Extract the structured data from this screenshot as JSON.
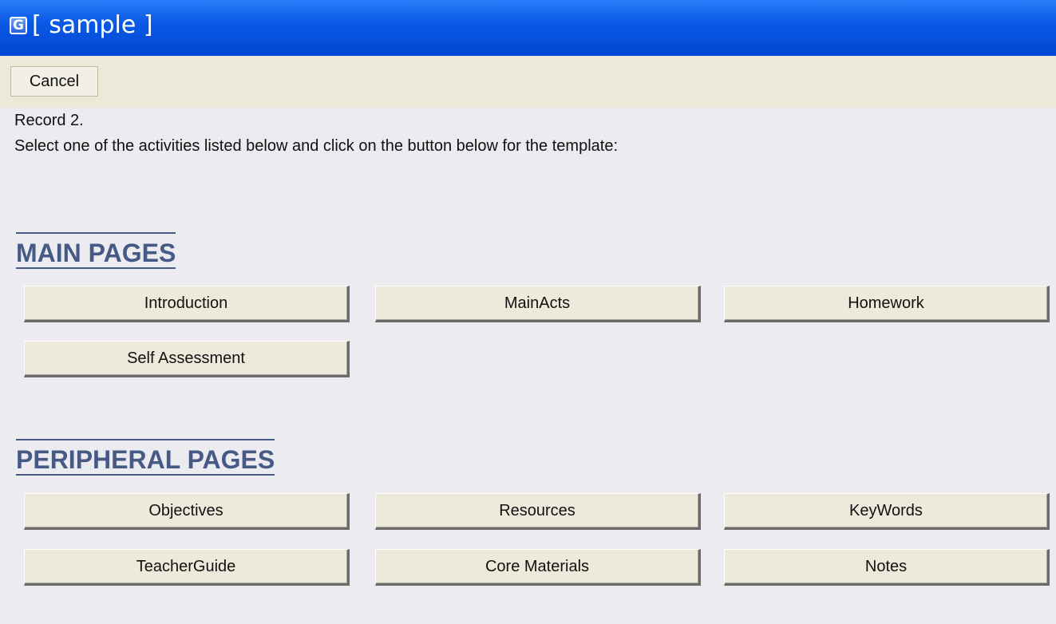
{
  "window": {
    "icon_glyph": "G",
    "icon_name": "app-icon",
    "title": "[ sample ]",
    "title_color": "#ffffff",
    "titlebar_color": "#0a5ae6"
  },
  "toolbar": {
    "cancel_label": "Cancel"
  },
  "content": {
    "record_text": "Record 2.",
    "instruction_text": "Select one of the activities listed below and click on the button below for the template:",
    "heading_color": "#475a86",
    "main_section": {
      "heading": "MAIN PAGES",
      "buttons": [
        "Introduction",
        "MainActs",
        "Homework",
        "Self Assessment"
      ]
    },
    "peripheral_section": {
      "heading": "PERIPHERAL PAGES",
      "buttons": [
        "Objectives",
        "Resources",
        "KeyWords",
        "TeacherGuide",
        "Core Materials",
        "Notes"
      ]
    }
  }
}
